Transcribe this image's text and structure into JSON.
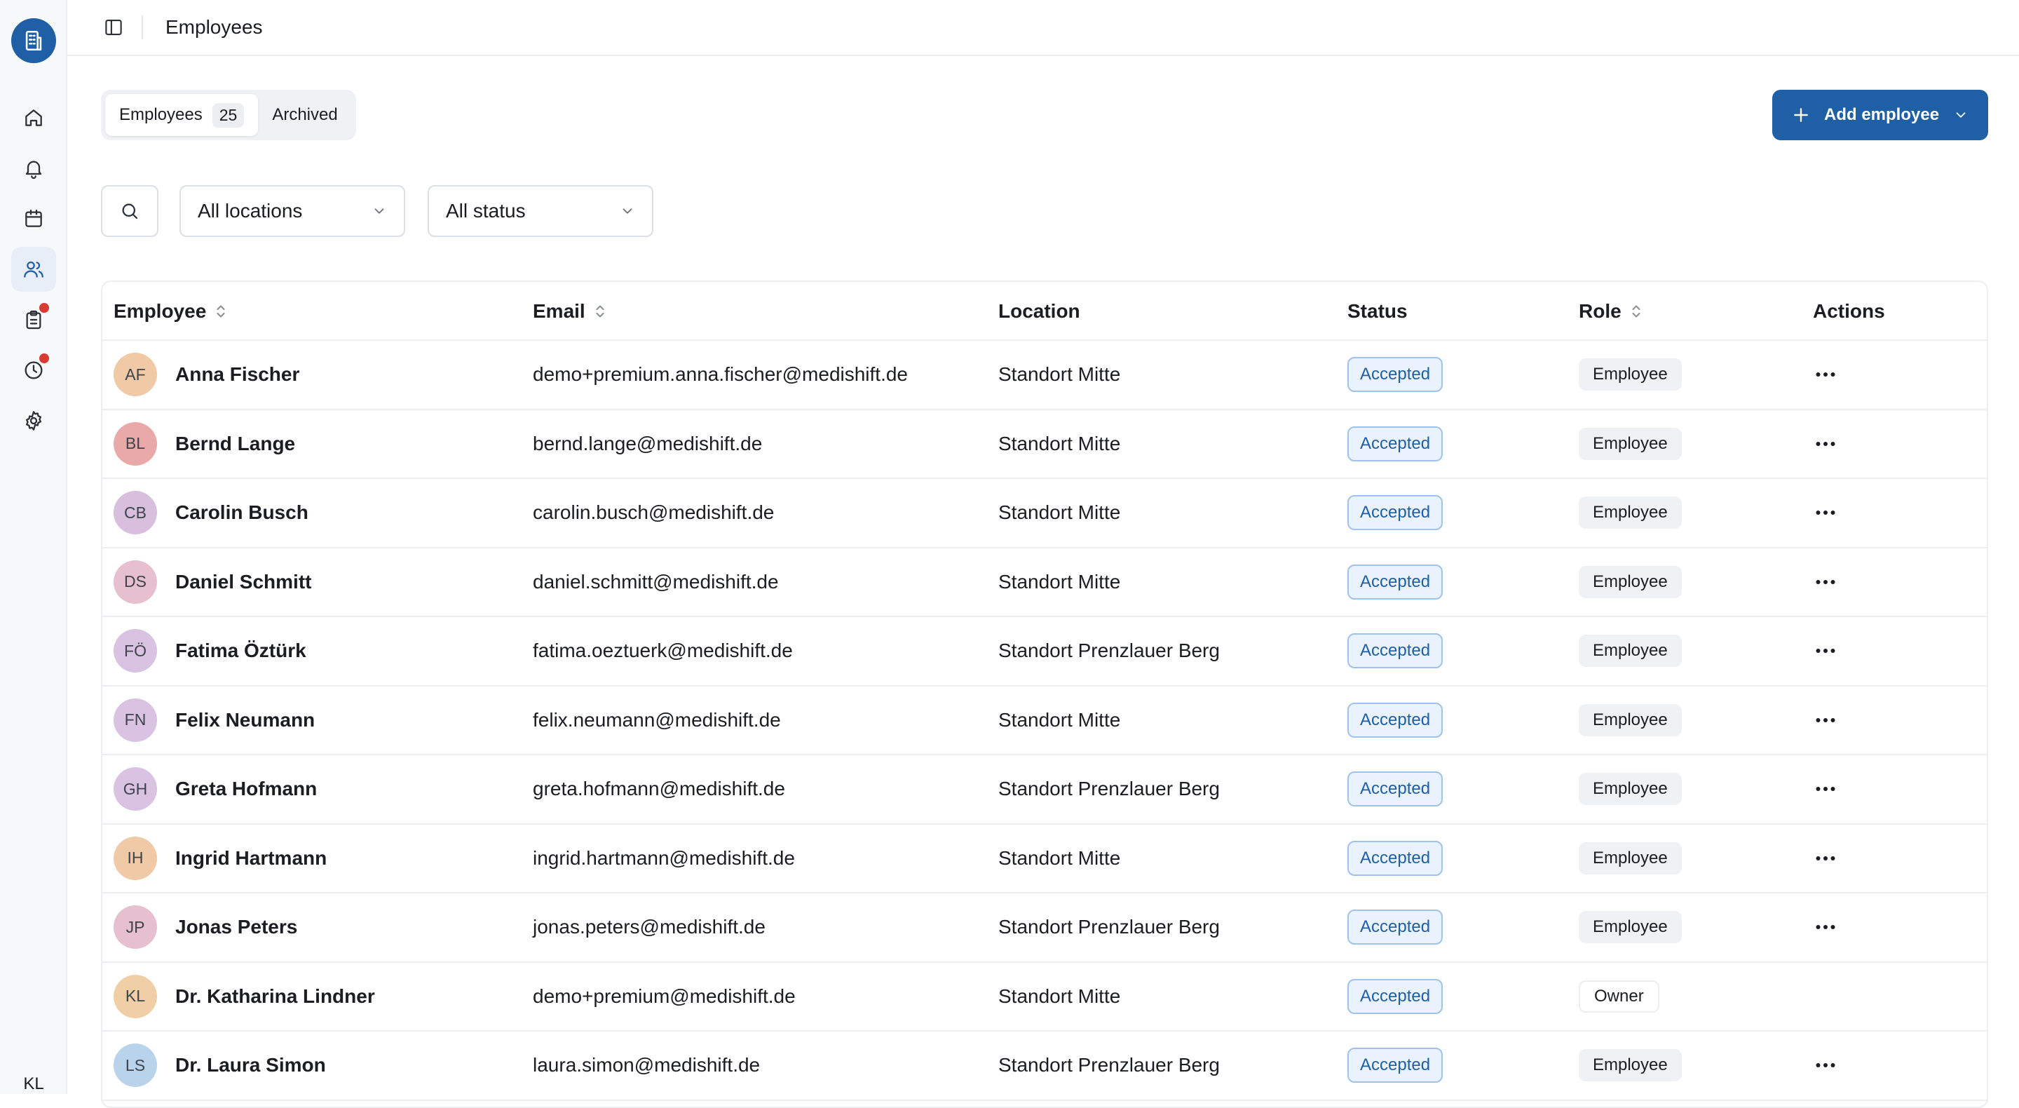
{
  "app": {
    "page_title": "Employees",
    "user_initials": "KL"
  },
  "sidebar": {
    "items": [
      {
        "icon": "home-icon"
      },
      {
        "icon": "bell-icon"
      },
      {
        "icon": "calendar-icon"
      },
      {
        "icon": "users-icon",
        "active": true
      },
      {
        "icon": "clipboard-icon",
        "badge": true
      },
      {
        "icon": "clock-icon",
        "badge": true
      },
      {
        "icon": "gear-icon"
      }
    ]
  },
  "tabs": {
    "employees_label": "Employees",
    "employees_count": "25",
    "archived_label": "Archived"
  },
  "actions": {
    "add_employee_label": "Add employee"
  },
  "filters": {
    "location": "All locations",
    "status": "All status"
  },
  "table": {
    "columns": {
      "employee": "Employee",
      "email": "Email",
      "location": "Location",
      "status": "Status",
      "role": "Role",
      "actions": "Actions"
    },
    "rows": [
      {
        "initials": "AF",
        "name": "Anna Fischer",
        "email": "demo+premium.anna.fischer@medishift.de",
        "location": "Standort Mitte",
        "status": "Accepted",
        "role": "Employee",
        "avatar_color": "#f0c9a6"
      },
      {
        "initials": "BL",
        "name": "Bernd Lange",
        "email": "bernd.lange@medishift.de",
        "location": "Standort Mitte",
        "status": "Accepted",
        "role": "Employee",
        "avatar_color": "#eaa9a9"
      },
      {
        "initials": "CB",
        "name": "Carolin Busch",
        "email": "carolin.busch@medishift.de",
        "location": "Standort Mitte",
        "status": "Accepted",
        "role": "Employee",
        "avatar_color": "#d7bfdd"
      },
      {
        "initials": "DS",
        "name": "Daniel Schmitt",
        "email": "daniel.schmitt@medishift.de",
        "location": "Standort Mitte",
        "status": "Accepted",
        "role": "Employee",
        "avatar_color": "#e6c0cf"
      },
      {
        "initials": "FÖ",
        "name": "Fatima Öztürk",
        "email": "fatima.oeztuerk@medishift.de",
        "location": "Standort Prenzlauer Berg",
        "status": "Accepted",
        "role": "Employee",
        "avatar_color": "#d9c2e2"
      },
      {
        "initials": "FN",
        "name": "Felix Neumann",
        "email": "felix.neumann@medishift.de",
        "location": "Standort Mitte",
        "status": "Accepted",
        "role": "Employee",
        "avatar_color": "#d9c2e2"
      },
      {
        "initials": "GH",
        "name": "Greta Hofmann",
        "email": "greta.hofmann@medishift.de",
        "location": "Standort Prenzlauer Berg",
        "status": "Accepted",
        "role": "Employee",
        "avatar_color": "#d9c2e2"
      },
      {
        "initials": "IH",
        "name": "Ingrid Hartmann",
        "email": "ingrid.hartmann@medishift.de",
        "location": "Standort Mitte",
        "status": "Accepted",
        "role": "Employee",
        "avatar_color": "#f0c9a6"
      },
      {
        "initials": "JP",
        "name": "Jonas Peters",
        "email": "jonas.peters@medishift.de",
        "location": "Standort Prenzlauer Berg",
        "status": "Accepted",
        "role": "Employee",
        "avatar_color": "#e6c0cf"
      },
      {
        "initials": "KL",
        "name": "Dr. Katharina Lindner",
        "email": "demo+premium@medishift.de",
        "location": "Standort Mitte",
        "status": "Accepted",
        "role": "Owner",
        "avatar_color": "#f0cfa6",
        "owner": true
      },
      {
        "initials": "LS",
        "name": "Dr. Laura Simon",
        "email": "laura.simon@medishift.de",
        "location": "Standort Prenzlauer Berg",
        "status": "Accepted",
        "role": "Employee",
        "avatar_color": "#b8d3ea"
      }
    ]
  },
  "colors": {
    "primary": "#1e5fa6",
    "status_accent": "#1e5fa6",
    "notification_dot": "#d93a36"
  }
}
